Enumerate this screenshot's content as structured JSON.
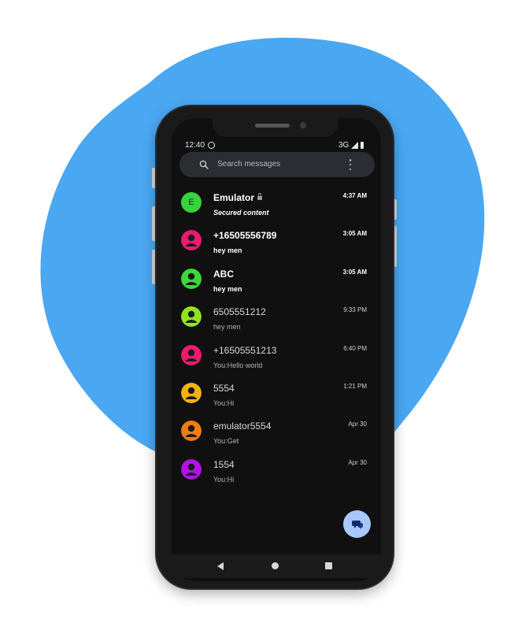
{
  "status_bar": {
    "time": "12:40",
    "network": "3G"
  },
  "search": {
    "placeholder": "Search messages"
  },
  "conversations": [
    {
      "name": "Emulator",
      "snippet": "Secured content",
      "time": "4:37 AM",
      "avatar_letter": "E",
      "avatar_color": "#35d33d",
      "unread": true,
      "locked": true
    },
    {
      "name": "+16505556789",
      "snippet": "hey men",
      "time": "3:05 AM",
      "avatar_color": "#ee1a6e",
      "unread": true
    },
    {
      "name": "ABC",
      "snippet": "hey men",
      "time": "3:05 AM",
      "avatar_color": "#3ad93a",
      "unread": true
    },
    {
      "name": "6505551212",
      "snippet": "hey men",
      "time": "9:33 PM",
      "avatar_color": "#8fe41f",
      "unread": false
    },
    {
      "name": "+16505551213",
      "snippet": "You:Hello world",
      "time": "6:40 PM",
      "avatar_color": "#ee1a6e",
      "unread": false
    },
    {
      "name": "5554",
      "snippet": "You:Hi",
      "time": "1:21 PM",
      "avatar_color": "#f3b211",
      "unread": false
    },
    {
      "name": "emulator5554",
      "snippet": "You:Get",
      "time": "Apr 30",
      "avatar_color": "#ef7d12",
      "unread": false
    },
    {
      "name": "1554",
      "snippet": "You:Hi",
      "time": "Apr 30",
      "avatar_color": "#b312e8",
      "unread": false
    }
  ],
  "icons": {
    "search": "search-icon",
    "more": "more-vert-icon",
    "fab": "start-chat-icon",
    "nav": [
      "back-icon",
      "home-icon",
      "recents-icon"
    ]
  },
  "colors": {
    "background_blob": "#4aa7f2",
    "screen_bg": "#101010",
    "fab_bg": "#a8c7fa"
  }
}
